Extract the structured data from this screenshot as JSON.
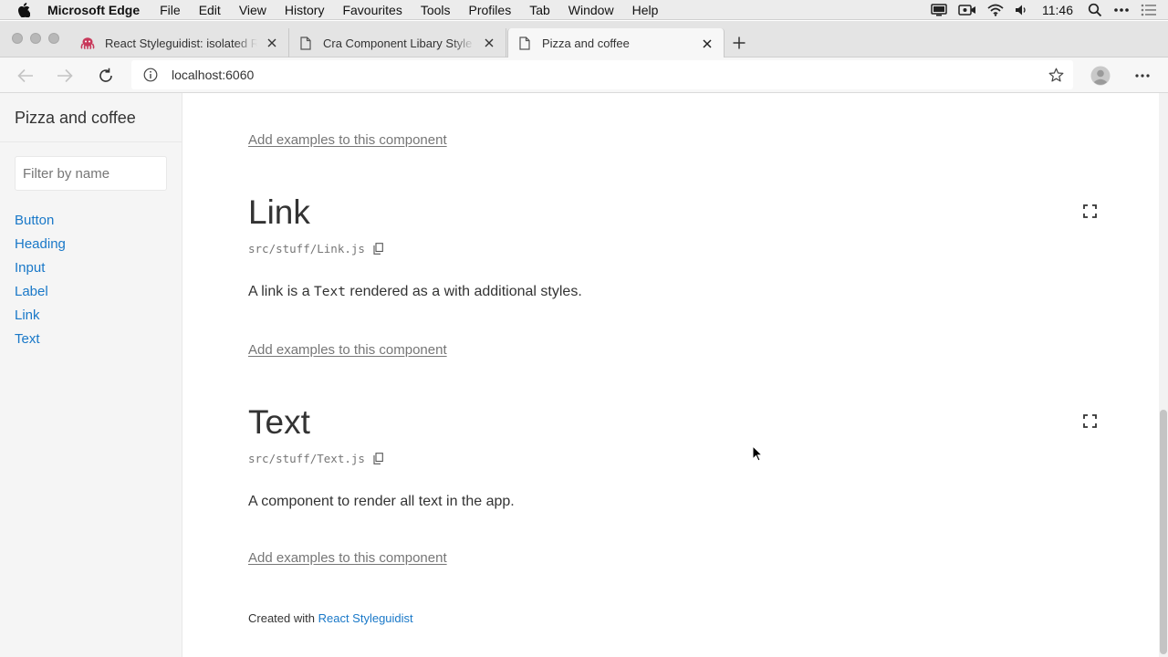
{
  "menubar": {
    "app_name": "Microsoft Edge",
    "items": [
      "File",
      "Edit",
      "View",
      "History",
      "Favourites",
      "Tools",
      "Profiles",
      "Tab",
      "Window",
      "Help"
    ],
    "clock": "11:46"
  },
  "tabs": [
    {
      "title": "React Styleguidist: isolated React component development environment",
      "icon": "octopus-icon",
      "active": false
    },
    {
      "title": "Cra Component Libary Style Guide",
      "icon": "page-icon",
      "active": false
    },
    {
      "title": "Pizza and coffee",
      "icon": "page-icon",
      "active": true
    }
  ],
  "address_bar": {
    "url": "localhost:6060"
  },
  "sidebar": {
    "title": "Pizza and coffee",
    "filter_placeholder": "Filter by name",
    "items": [
      "Button",
      "Heading",
      "Input",
      "Label",
      "Link",
      "Text"
    ]
  },
  "content": {
    "add_examples_label": "Add examples to this component",
    "components": [
      {
        "name": "Link",
        "path": "src/stuff/Link.js",
        "desc_before": "A link is a ",
        "desc_code": "Text",
        "desc_after": " rendered as a with additional styles."
      },
      {
        "name": "Text",
        "path": "src/stuff/Text.js",
        "desc_before": "A component to render all text in the app.",
        "desc_code": "",
        "desc_after": ""
      }
    ],
    "footer_prefix": "Created with ",
    "footer_link": "React Styleguidist"
  },
  "colors": {
    "link": "#1978c8",
    "muted": "#767676",
    "sidebar_bg": "#f5f5f5"
  }
}
